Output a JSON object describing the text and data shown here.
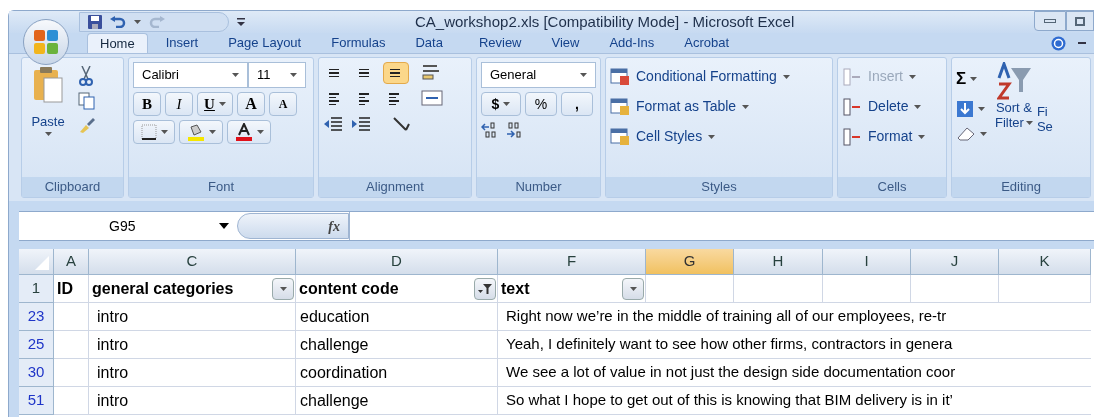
{
  "window": {
    "title": "CA_workshop2.xls  [Compatibility Mode] - Microsoft Excel"
  },
  "tabs": [
    {
      "label": "Home",
      "selected": true
    },
    {
      "label": "Insert",
      "selected": false
    },
    {
      "label": "Page Layout",
      "selected": false
    },
    {
      "label": "Formulas",
      "selected": false
    },
    {
      "label": "Data",
      "selected": false
    },
    {
      "label": "Review",
      "selected": false
    },
    {
      "label": "View",
      "selected": false
    },
    {
      "label": "Add-Ins",
      "selected": false
    },
    {
      "label": "Acrobat",
      "selected": false
    }
  ],
  "ribbon": {
    "clipboard": {
      "label": "Clipboard",
      "paste": "Paste"
    },
    "font": {
      "label": "Font",
      "font_name": "Calibri",
      "font_size": "11",
      "bold": "B",
      "italic": "I",
      "underline": "U",
      "grow": "A",
      "shrink": "A"
    },
    "alignment": {
      "label": "Alignment",
      "vertical": [
        {
          "selected": false
        },
        {
          "selected": false
        },
        {
          "selected": true
        }
      ]
    },
    "number": {
      "label": "Number",
      "format": "General",
      "currency": "$",
      "percent": "%",
      "comma": ","
    },
    "styles": {
      "label": "Styles",
      "items": [
        "Conditional Formatting",
        "Format as Table",
        "Cell Styles"
      ]
    },
    "cells": {
      "label": "Cells",
      "items": [
        {
          "label": "Insert",
          "disabled": true
        },
        {
          "label": "Delete",
          "disabled": false
        },
        {
          "label": "Format",
          "disabled": false
        }
      ]
    },
    "editing": {
      "label": "Editing",
      "sum": "Σ",
      "sort": [
        "Sort &",
        "Filter"
      ],
      "find": [
        "Fi",
        "Se"
      ]
    }
  },
  "formula_bar": {
    "name_box": "G95",
    "function_label": "fx"
  },
  "columns": [
    {
      "label": "A",
      "selected": false
    },
    {
      "label": "C",
      "selected": false
    },
    {
      "label": "D",
      "selected": false
    },
    {
      "label": "F",
      "selected": false
    },
    {
      "label": "G",
      "selected": true
    },
    {
      "label": "H",
      "selected": false
    },
    {
      "label": "I",
      "selected": false
    },
    {
      "label": "J",
      "selected": false
    },
    {
      "label": "K",
      "selected": false
    }
  ],
  "header_row": {
    "number": "1",
    "cells": [
      {
        "text": "ID",
        "kind": "plain"
      },
      {
        "text": "general categories",
        "kind": "dropdown"
      },
      {
        "text": "content code",
        "kind": "filtered"
      },
      {
        "text": "text",
        "kind": "dropdown"
      }
    ]
  },
  "rows": [
    {
      "number": "23",
      "category": "intro",
      "code": "education",
      "text": "Right now we’re in the middle of training all of our employees, re-tr"
    },
    {
      "number": "25",
      "category": "intro",
      "code": "challenge",
      "text": "Yeah, I definitely want to see how other firms, contractors in genera"
    },
    {
      "number": "30",
      "category": "intro",
      "code": "coordination",
      "text": "We see a lot of value in not just the design side documentation coor"
    },
    {
      "number": "51",
      "category": "intro",
      "code": "challenge",
      "text": "So what I hope to get out of this is knowing that BIM delivery is in it’"
    }
  ]
}
